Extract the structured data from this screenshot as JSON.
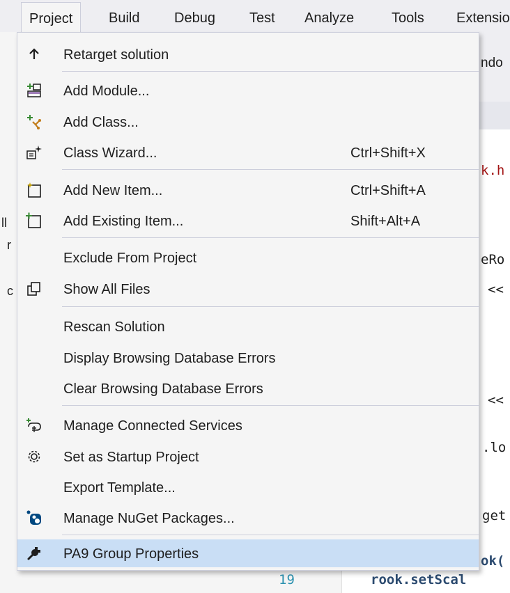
{
  "menubar": {
    "items": [
      {
        "label": "Project",
        "active": true
      },
      {
        "label": "Build"
      },
      {
        "label": "Debug"
      },
      {
        "label": "Test"
      },
      {
        "label": "Analyze"
      },
      {
        "label": "Tools"
      },
      {
        "label": "Extensio"
      }
    ]
  },
  "background": {
    "toolbar_text": "ndo",
    "code": [
      {
        "text": "k.h"
      },
      {
        "text": "eRo"
      },
      {
        "text": "<<"
      },
      {
        "text": "<<"
      },
      {
        "text": ".lo"
      },
      {
        "text": "get"
      },
      {
        "text": "ok("
      },
      {
        "text": "rook.setScal"
      }
    ],
    "line_number": "19",
    "left_fragments": [
      "ll",
      "r",
      "c"
    ]
  },
  "menu": {
    "items": [
      {
        "label": "Retarget solution",
        "icon": "arrow-up-icon"
      },
      {
        "label": "Add Module...",
        "icon": "add-module-icon"
      },
      {
        "label": "Add Class...",
        "icon": "add-class-icon"
      },
      {
        "label": "Class Wizard...",
        "shortcut": "Ctrl+Shift+X",
        "icon": "class-wizard-icon"
      },
      {
        "label": "Add New Item...",
        "shortcut": "Ctrl+Shift+A",
        "icon": "add-new-item-icon"
      },
      {
        "label": "Add Existing Item...",
        "shortcut": "Shift+Alt+A",
        "icon": "add-existing-item-icon"
      },
      {
        "label": "Exclude From Project"
      },
      {
        "label": "Show All Files",
        "icon": "show-all-files-icon"
      },
      {
        "label": "Rescan Solution"
      },
      {
        "label": "Display Browsing Database Errors"
      },
      {
        "label": "Clear Browsing Database Errors"
      },
      {
        "label": "Manage Connected Services",
        "icon": "connected-services-icon"
      },
      {
        "label": "Set as Startup Project",
        "icon": "gear-icon"
      },
      {
        "label": "Export Template..."
      },
      {
        "label": "Manage NuGet Packages...",
        "icon": "nuget-icon"
      },
      {
        "label": "PA9 Group Properties",
        "icon": "wrench-icon",
        "highlighted": true
      }
    ]
  },
  "colors": {
    "highlight": "#c9def5",
    "menu_bg": "#f5f5f5",
    "border": "#cccedb",
    "accent": "#007acc"
  }
}
